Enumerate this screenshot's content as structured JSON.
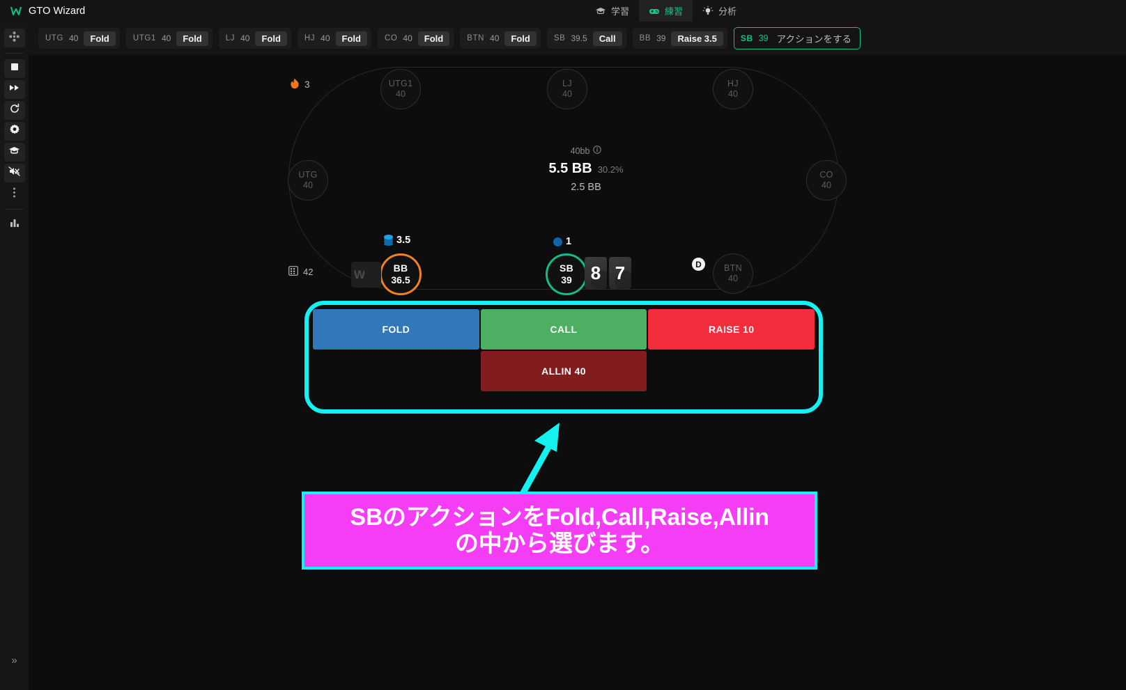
{
  "app": {
    "title": "GTO Wizard",
    "logo_glyph": "W"
  },
  "topnav": [
    {
      "label": "学習",
      "icon": "graduation-cap-icon",
      "active": false
    },
    {
      "label": "練習",
      "icon": "gamepad-icon",
      "active": true
    },
    {
      "label": "分析",
      "icon": "lightbulb-icon",
      "active": false
    }
  ],
  "rail": {
    "items": [
      {
        "name": "move-tool",
        "icon": "move-cross-icon"
      },
      {
        "name": "stop",
        "icon": "stop-square-icon"
      },
      {
        "name": "fast-forward",
        "icon": "fast-forward-icon"
      },
      {
        "name": "refresh",
        "icon": "refresh-icon"
      },
      {
        "name": "settings",
        "icon": "gear-icon"
      },
      {
        "name": "study",
        "icon": "graduation-cap-icon"
      },
      {
        "name": "mute",
        "icon": "speaker-muted-icon"
      },
      {
        "name": "more",
        "icon": "vertical-dots-icon"
      },
      {
        "name": "stats",
        "icon": "bar-chart-icon"
      }
    ],
    "expand_glyph": "»"
  },
  "history": {
    "pills": [
      {
        "position": "UTG",
        "stack": "40",
        "action": "Fold"
      },
      {
        "position": "UTG1",
        "stack": "40",
        "action": "Fold"
      },
      {
        "position": "LJ",
        "stack": "40",
        "action": "Fold"
      },
      {
        "position": "HJ",
        "stack": "40",
        "action": "Fold"
      },
      {
        "position": "CO",
        "stack": "40",
        "action": "Fold"
      },
      {
        "position": "BTN",
        "stack": "40",
        "action": "Fold"
      },
      {
        "position": "SB",
        "stack": "39.5",
        "action": "Call"
      },
      {
        "position": "BB",
        "stack": "39",
        "action": "Raise 3.5"
      }
    ],
    "current": {
      "position": "SB",
      "stack": "39",
      "prompt": "アクションをする"
    }
  },
  "table": {
    "streak": {
      "icon": "flame-icon",
      "value": "3"
    },
    "handcount": {
      "icon": "grid-icon",
      "value": "42"
    },
    "pot": {
      "stack_label": "40bb",
      "info_icon": "info-icon",
      "amount": "5.5 BB",
      "equity": "30.2%",
      "sub_amount": "2.5 BB"
    },
    "seats": [
      {
        "position": "UTG1",
        "stack": "40",
        "state": "folded"
      },
      {
        "position": "LJ",
        "stack": "40",
        "state": "folded"
      },
      {
        "position": "HJ",
        "stack": "40",
        "state": "folded"
      },
      {
        "position": "CO",
        "stack": "40",
        "state": "folded"
      },
      {
        "position": "BTN",
        "stack": "40",
        "state": "folded"
      },
      {
        "position": "UTG",
        "stack": "40",
        "state": "folded"
      }
    ],
    "villain": {
      "position": "BB",
      "stack": "36.5",
      "ring_color": "#f08226"
    },
    "hero": {
      "position": "SB",
      "stack": "39",
      "ring_color": "#17b98c"
    },
    "bets": [
      {
        "owner": "BB",
        "amount": "3.5",
        "chip": "stack"
      },
      {
        "owner": "SB",
        "amount": "1",
        "chip": "single"
      }
    ],
    "hole_cards": [
      {
        "rank": "8",
        "suit": "spade"
      },
      {
        "rank": "7",
        "suit": "spade"
      }
    ],
    "facedown_logo": "W",
    "dealer_button": "D"
  },
  "actions": {
    "fold": {
      "label": "FOLD",
      "color": "#3278b8"
    },
    "call": {
      "label": "CALL",
      "color": "#4caf62"
    },
    "raise": {
      "label": "RAISE 10",
      "color": "#f32d3c"
    },
    "allin": {
      "label": "ALLIN 40",
      "color": "#811c1f"
    }
  },
  "callout": {
    "line1": "SBのアクションをFold,Call,Raise,Allin",
    "line2": "の中から選びます。",
    "background": "#f43df4",
    "border": "#14f1f1"
  }
}
